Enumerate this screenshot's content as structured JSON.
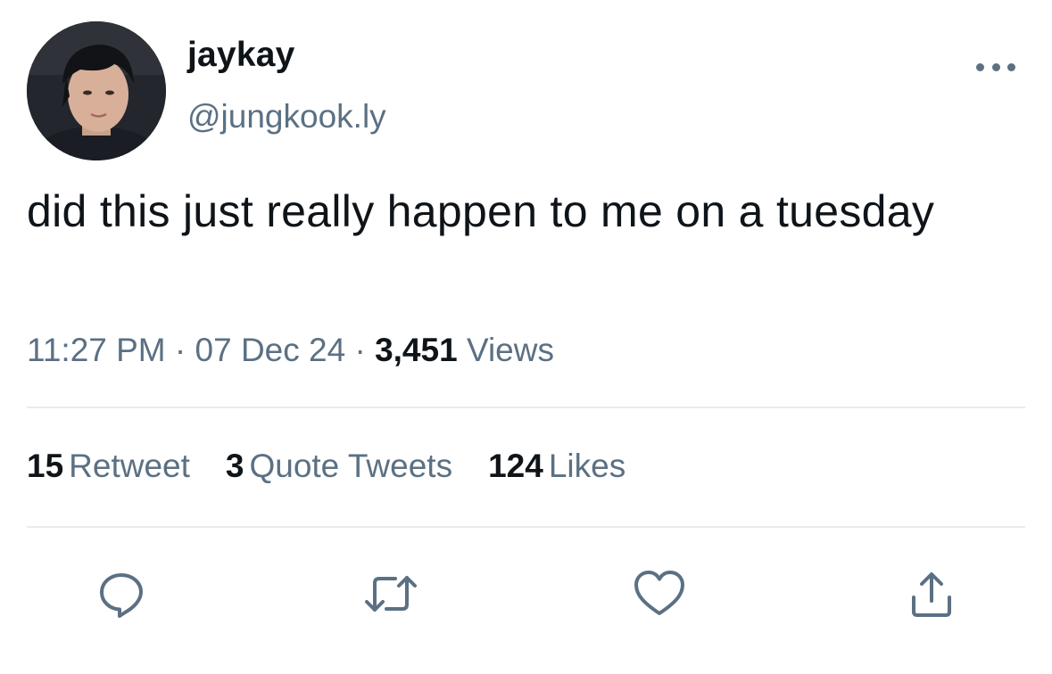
{
  "user": {
    "display_name": "jaykay",
    "handle": "@jungkook.ly",
    "avatar_icon": "avatar-photo"
  },
  "tweet": {
    "text": "did this just really happen to me on a tuesday",
    "time": "11:27 PM",
    "date": "07 Dec 24",
    "views_count": "3,451",
    "views_label": "Views",
    "separator": "·"
  },
  "stats": {
    "retweets": {
      "count": "15",
      "label": "Retweet"
    },
    "quotes": {
      "count": "3",
      "label": "Quote Tweets"
    },
    "likes": {
      "count": "124",
      "label": "Likes"
    }
  },
  "actions": [
    {
      "icon": "reply-icon"
    },
    {
      "icon": "retweet-icon"
    },
    {
      "icon": "like-icon"
    },
    {
      "icon": "share-icon"
    }
  ],
  "colors": {
    "text_primary": "#0f1419",
    "text_secondary": "#5b7083",
    "divider": "#e6ecf0",
    "background": "#ffffff"
  }
}
